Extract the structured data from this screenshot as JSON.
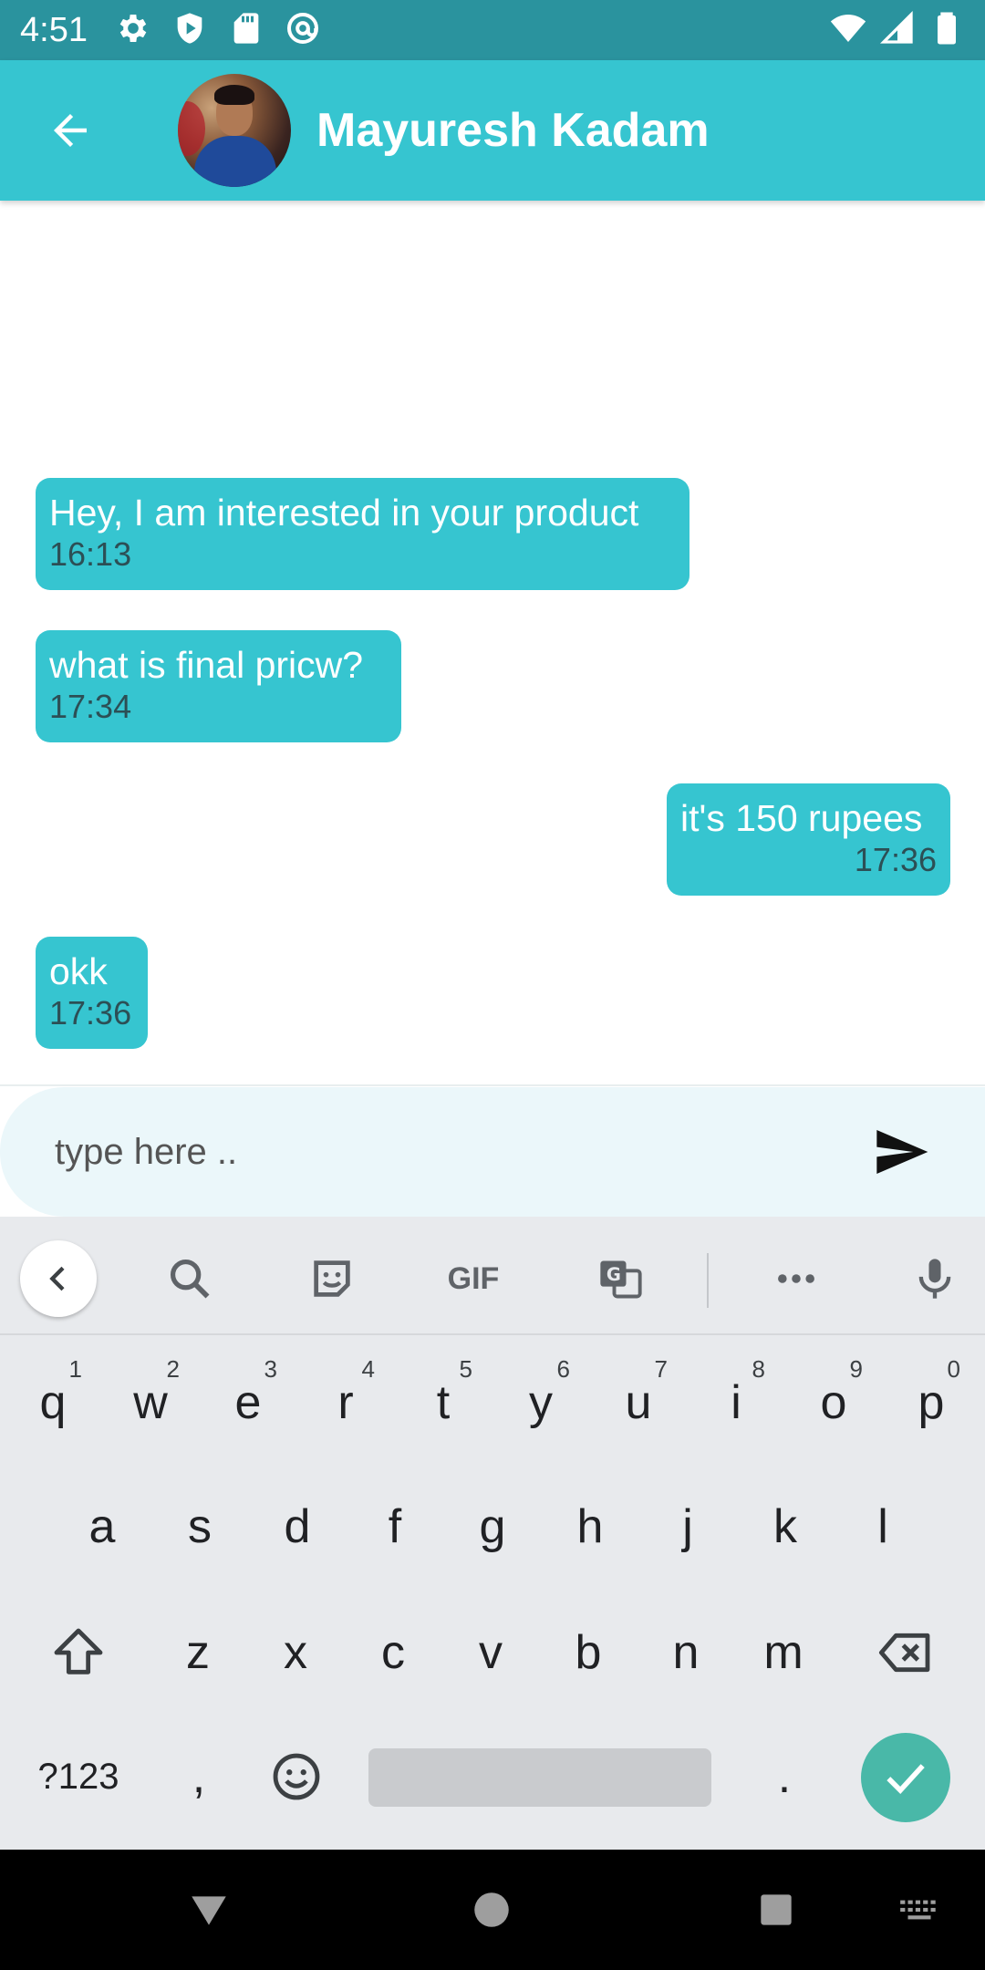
{
  "status_bar": {
    "time": "4:51",
    "left_icons": [
      "settings-icon",
      "shield-play-icon",
      "sd-card-icon",
      "at-sign-icon"
    ],
    "right_icons": [
      "wifi-icon",
      "signal-icon",
      "battery-icon"
    ]
  },
  "app_bar": {
    "contact_name": "Mayuresh Kadam",
    "back_icon": "arrow-back-icon",
    "background_color": "#36c5d0"
  },
  "messages": [
    {
      "text": "Hey, I am interested in your product",
      "time": "16:13",
      "direction": "incoming"
    },
    {
      "text": "what is final pricw?",
      "time": "17:34",
      "direction": "incoming"
    },
    {
      "text": "it's 150 rupees",
      "time": "17:36",
      "direction": "outgoing"
    },
    {
      "text": "okk",
      "time": "17:36",
      "direction": "incoming"
    }
  ],
  "input": {
    "placeholder": "type here ..",
    "value": "",
    "send_icon": "send-icon"
  },
  "keyboard": {
    "toolbar": {
      "items": [
        "back-chevron-icon",
        "search-icon",
        "sticker-icon",
        "gif-icon",
        "translate-icon",
        "more-icon",
        "microphone-icon"
      ],
      "gif_label": "GIF"
    },
    "row1": [
      {
        "key": "q",
        "num": "1"
      },
      {
        "key": "w",
        "num": "2"
      },
      {
        "key": "e",
        "num": "3"
      },
      {
        "key": "r",
        "num": "4"
      },
      {
        "key": "t",
        "num": "5"
      },
      {
        "key": "y",
        "num": "6"
      },
      {
        "key": "u",
        "num": "7"
      },
      {
        "key": "i",
        "num": "8"
      },
      {
        "key": "o",
        "num": "9"
      },
      {
        "key": "p",
        "num": "0"
      }
    ],
    "row2": [
      "a",
      "s",
      "d",
      "f",
      "g",
      "h",
      "j",
      "k",
      "l"
    ],
    "row3": [
      "z",
      "x",
      "c",
      "v",
      "b",
      "n",
      "m"
    ],
    "row4": {
      "symbols": "?123",
      "comma": ",",
      "period": "."
    },
    "accent_color": "#49b8a8"
  },
  "nav_bar": {
    "buttons": [
      "back-triangle-icon",
      "home-circle-icon",
      "recents-square-icon",
      "keyboard-switch-icon"
    ]
  }
}
